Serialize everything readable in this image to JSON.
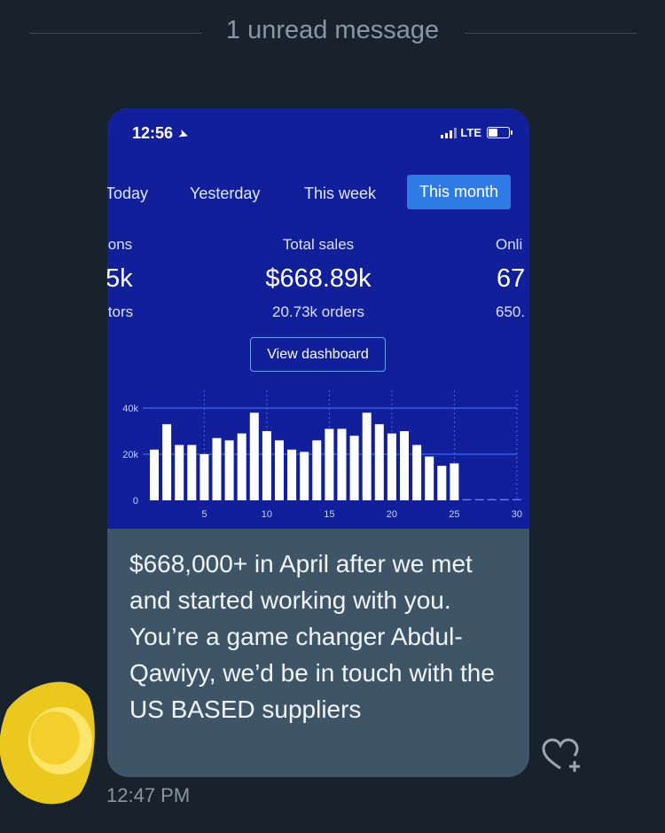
{
  "divider": {
    "text": "1 unread message"
  },
  "screenshot": {
    "status": {
      "time": "12:56",
      "network": "LTE"
    },
    "tabs": [
      {
        "label": "Today",
        "active": false
      },
      {
        "label": "Yesterday",
        "active": false
      },
      {
        "label": "This week",
        "active": false
      },
      {
        "label": "This month",
        "active": true
      }
    ],
    "left_stat": {
      "label": "ions",
      "value": "5k",
      "sub": "itors"
    },
    "center_stat": {
      "label": "Total sales",
      "value": "$668.89k",
      "sub": "20.73k orders"
    },
    "right_stat": {
      "label": "Onli",
      "value": "67",
      "sub": "650."
    },
    "view_button": "View dashboard"
  },
  "chart_data": {
    "type": "bar",
    "ylim": [
      0,
      45000
    ],
    "y_ticks": [
      {
        "value": 0,
        "label": "0"
      },
      {
        "value": 20000,
        "label": "20k"
      },
      {
        "value": 40000,
        "label": "40k"
      }
    ],
    "x_ticks": [
      5,
      10,
      15,
      20,
      25,
      30
    ],
    "x": [
      1,
      2,
      3,
      4,
      5,
      6,
      7,
      8,
      9,
      10,
      11,
      12,
      13,
      14,
      15,
      16,
      17,
      18,
      19,
      20,
      21,
      22,
      23,
      24,
      25,
      26,
      27,
      28,
      29,
      30
    ],
    "values": [
      22000,
      33000,
      24000,
      24000,
      20000,
      27000,
      26000,
      29000,
      38000,
      30000,
      26000,
      22000,
      21000,
      26000,
      31000,
      31000,
      28000,
      38000,
      33000,
      29000,
      30000,
      24000,
      19000,
      15000,
      16000,
      500,
      500,
      500,
      500,
      500
    ]
  },
  "message": {
    "text": "$668,000+ in April after we met and started working with you. You’re a game changer Abdul-Qawiyy, we’d be in touch with the US BASED suppliers",
    "timestamp": "12:47 PM"
  },
  "colors": {
    "background": "#18222c",
    "bubble": "#3e5568",
    "screenshot_bg": "#11209a",
    "accent": "#2f7be6",
    "bars": "#ffffff"
  }
}
